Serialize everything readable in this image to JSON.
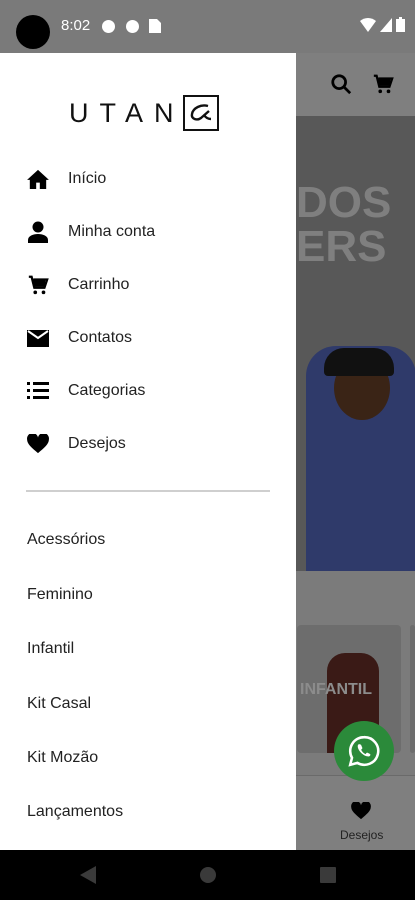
{
  "status_bar": {
    "time": "8:02"
  },
  "brand": {
    "logo_text": "UTAN"
  },
  "menu": [
    {
      "label": "Início",
      "icon": "home-icon"
    },
    {
      "label": "Minha conta",
      "icon": "person-icon"
    },
    {
      "label": "Carrinho",
      "icon": "cart-icon"
    },
    {
      "label": "Contatos",
      "icon": "mail-icon"
    },
    {
      "label": "Categorias",
      "icon": "list-icon"
    },
    {
      "label": "Desejos",
      "icon": "heart-icon"
    }
  ],
  "categories": [
    {
      "label": "Acessórios"
    },
    {
      "label": "Feminino"
    },
    {
      "label": "Infantil"
    },
    {
      "label": "Kit Casal"
    },
    {
      "label": "Kit Mozão"
    },
    {
      "label": "Lançamentos"
    }
  ],
  "background": {
    "hero_text_line1": "DOS",
    "hero_text_line2": "ERS",
    "card_text": "INFANTIL",
    "bottom_nav_label": "Desejos"
  },
  "colors": {
    "whatsapp_green": "#2b8a3a",
    "scrim": "#7b7b7b",
    "drawer_bg": "#ffffff"
  }
}
